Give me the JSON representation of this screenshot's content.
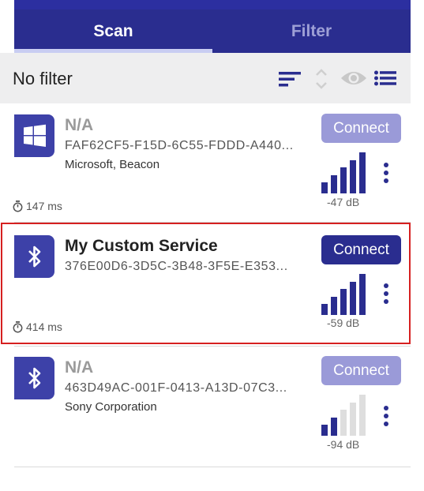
{
  "tabs": [
    {
      "label": "Scan",
      "active": true
    },
    {
      "label": "Filter",
      "active": false
    }
  ],
  "filter": {
    "label": "No filter"
  },
  "devices": [
    {
      "name": "N/A",
      "uuid": "FAF62CF5-F15D-6C55-FDDD-A440...",
      "info": "Microsoft, Beacon",
      "interval": "147 ms",
      "rssi": "-47 dB",
      "signal_bars": 5,
      "connect_label": "Connect",
      "icon": "windows-icon"
    },
    {
      "name": "My Custom Service",
      "uuid": "376E00D6-3D5C-3B48-3F5E-E353...",
      "info": "",
      "interval": "414 ms",
      "rssi": "-59 dB",
      "signal_bars": 5,
      "connect_label": "Connect",
      "icon": "bluetooth-icon"
    },
    {
      "name": "N/A",
      "uuid": "463D49AC-001F-0413-A13D-07C3...",
      "info": "Sony Corporation",
      "interval": "",
      "rssi": "-94 dB",
      "signal_bars": 2,
      "connect_label": "Connect",
      "icon": "bluetooth-icon"
    }
  ],
  "colors": {
    "primary": "#2a2d8f",
    "primary_light": "#9a9ad8",
    "highlight": "#d62020"
  }
}
